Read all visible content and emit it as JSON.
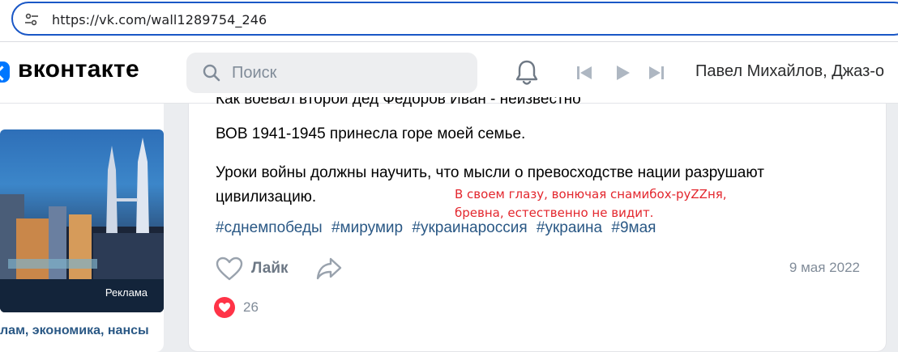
{
  "browser": {
    "url": "https://vk.com/wall1289754_246",
    "site_icon": "tune-icon"
  },
  "header": {
    "logo_text": "вконтакте",
    "search": {
      "placeholder": "Поиск"
    },
    "now_playing": "Павел Михайлов, Джаз-о",
    "icons": [
      "bell-icon",
      "skip-back-icon",
      "play-icon",
      "skip-forward-icon"
    ]
  },
  "ad": {
    "label": "Реклама",
    "text": "лам, экономика, нансы"
  },
  "post": {
    "cut_line": "Как воевал второй дед Федоров Иван - неизвестно",
    "line1": "ВОВ 1941-1945 принесла горе моей семье.",
    "line2": "Уроки войны должны научить, что мысли о превосходстве нации разрушают цивилизацию.",
    "annotation_line1": "В своем глазу, вонючая снамибох-руZZня,",
    "annotation_line2": "бревна, естественно не видит.",
    "hashtags": [
      "#сднемпобеды",
      "#мирумир",
      "#украинароссия",
      "#украина",
      "#9мая"
    ],
    "like_label": "Лайк",
    "date": "9 мая 2022",
    "reaction_count": "26"
  },
  "colors": {
    "accent": "#0077ff",
    "link": "#2a5885",
    "annotation": "#e3262d",
    "reaction": "#ff3347"
  }
}
